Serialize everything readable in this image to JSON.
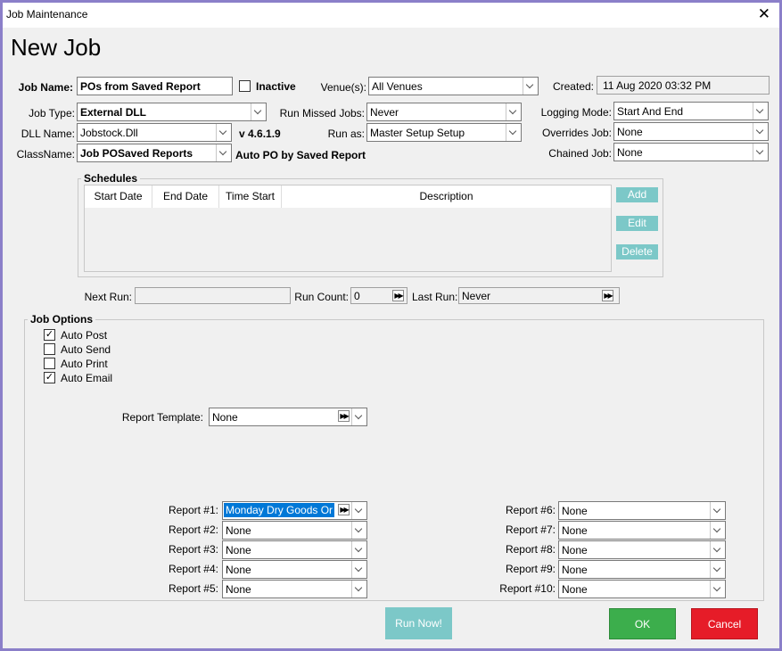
{
  "window": {
    "title": "Job Maintenance",
    "close": "✕"
  },
  "page_title": "New Job",
  "job_name": {
    "label": "Job Name:",
    "value": "POs from Saved Report"
  },
  "inactive": {
    "label": "Inactive",
    "checked": false
  },
  "venues": {
    "label": "Venue(s):",
    "value": "All Venues"
  },
  "created": {
    "label": "Created:",
    "value": "11 Aug 2020 03:32 PM"
  },
  "job_type": {
    "label": "Job Type:",
    "value": "External DLL"
  },
  "run_missed": {
    "label": "Run Missed Jobs:",
    "value": "Never"
  },
  "logging": {
    "label": "Logging Mode:",
    "value": "Start And End"
  },
  "dll_name": {
    "label": "DLL Name:",
    "value": "Jobstock.Dll",
    "version": "v 4.6.1.9"
  },
  "run_as": {
    "label": "Run as:",
    "value": "Master Setup  Setup"
  },
  "overrides": {
    "label": "Overrides Job:",
    "value": "None"
  },
  "class_name": {
    "label": "ClassName:",
    "value": "Job POSaved Reports",
    "desc": "Auto PO by Saved Report"
  },
  "chained": {
    "label": "Chained Job:",
    "value": "None"
  },
  "schedules": {
    "title": "Schedules",
    "columns": [
      "Start Date",
      "End Date",
      "Time Start",
      "Description"
    ],
    "add": "Add",
    "edit": "Edit",
    "delete": "Delete"
  },
  "next_run": {
    "label": "Next Run:",
    "value": ""
  },
  "run_count": {
    "label": "Run Count:",
    "value": "0"
  },
  "last_run": {
    "label": "Last Run:",
    "value": "Never"
  },
  "job_options": {
    "title": "Job Options",
    "auto_post": {
      "label": "Auto Post",
      "checked": true
    },
    "auto_send": {
      "label": "Auto Send",
      "checked": false
    },
    "auto_print": {
      "label": "Auto Print",
      "checked": false
    },
    "auto_email": {
      "label": "Auto Email",
      "checked": true
    }
  },
  "report_template": {
    "label": "Report Template:",
    "value": "None"
  },
  "reports_left": [
    {
      "label": "Report #1:",
      "value": "Monday Dry Goods Or"
    },
    {
      "label": "Report #2:",
      "value": "None"
    },
    {
      "label": "Report #3:",
      "value": "None"
    },
    {
      "label": "Report #4:",
      "value": "None"
    },
    {
      "label": "Report #5:",
      "value": "None"
    }
  ],
  "reports_right": [
    {
      "label": "Report #6:",
      "value": "None"
    },
    {
      "label": "Report #7:",
      "value": "None"
    },
    {
      "label": "Report #8:",
      "value": "None"
    },
    {
      "label": "Report #9:",
      "value": "None"
    },
    {
      "label": "Report #10:",
      "value": "None"
    }
  ],
  "buttons": {
    "run_now": "Run Now!",
    "ok": "OK",
    "cancel": "Cancel"
  },
  "colors": {
    "border": "#8b7fc9",
    "teal": "#7cc8c8",
    "ok": "#3cae4c",
    "cancel": "#e61c28",
    "selection": "#0078d7"
  }
}
